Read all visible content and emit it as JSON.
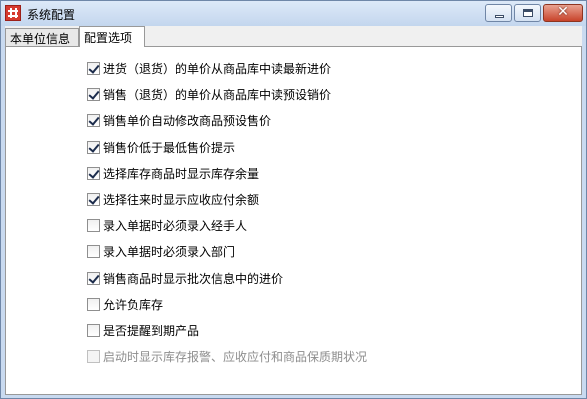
{
  "window": {
    "title": "系统配置",
    "icon": "app-logo-icon",
    "controls": {
      "minimize": "minimize-icon",
      "maximize": "maximize-icon",
      "close": "close-icon",
      "close_glyph": "✕"
    }
  },
  "tabs": [
    {
      "label": "本单位信息",
      "active": false
    },
    {
      "label": "配置选项",
      "active": true
    }
  ],
  "options": [
    {
      "label": "进货（退货）的单价从商品库中读最新进价",
      "checked": true,
      "enabled": true
    },
    {
      "label": "销售（退货）的单价从商品库中读预设销价",
      "checked": true,
      "enabled": true
    },
    {
      "label": "销售单价自动修改商品预设售价",
      "checked": true,
      "enabled": true
    },
    {
      "label": "销售价低于最低售价提示",
      "checked": true,
      "enabled": true
    },
    {
      "label": "选择库存商品时显示库存余量",
      "checked": true,
      "enabled": true
    },
    {
      "label": "选择往来时显示应收应付余额",
      "checked": true,
      "enabled": true
    },
    {
      "label": "录入单据时必须录入经手人",
      "checked": false,
      "enabled": true
    },
    {
      "label": "录入单据时必须录入部门",
      "checked": false,
      "enabled": true
    },
    {
      "label": "销售商品时显示批次信息中的进价",
      "checked": true,
      "enabled": true
    },
    {
      "label": "允许负库存",
      "checked": false,
      "enabled": true
    },
    {
      "label": "是否提醒到期产品",
      "checked": false,
      "enabled": true
    },
    {
      "label": "启动时显示库存报警、应收应付和商品保质期状况",
      "checked": false,
      "enabled": false
    }
  ]
}
